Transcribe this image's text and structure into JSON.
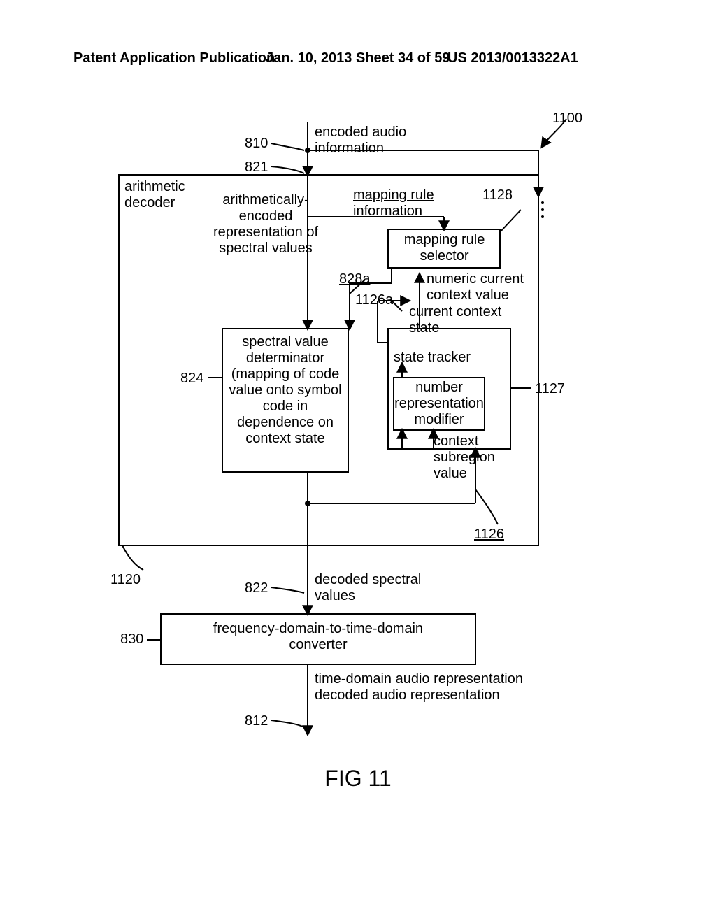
{
  "header": {
    "left": "Patent Application Publication",
    "center": "Jan. 10, 2013  Sheet 34 of 59",
    "right": "US 2013/0013322A1"
  },
  "labels": {
    "encoded_audio": "encoded audio\ninformation",
    "arithmetic_decoder": "arithmetic\ndecoder",
    "arith_encoded": "arithmetically-\nencoded\nrepresentation of\nspectral values",
    "mapping_rule_info": "mapping rule\ninformation",
    "mapping_rule_selector": "mapping rule\nselector",
    "numeric_current": "numeric current\ncontext value",
    "spectral_value_det": "spectral value\ndeterminator\n(mapping of code\nvalue onto symbol\ncode in\ndependence on\ncontext state",
    "current_context_state": "current context\nstate",
    "state_tracker": "state tracker",
    "number_rep_mod": "number\nrepresentation\nmodifier",
    "context_subregion_value": "context\nsubregion\nvalue",
    "decoded_spectral": "decoded spectral\nvalues",
    "converter": "frequency-domain-to-time-domain\nconverter",
    "time_domain": "time-domain audio representation\ndecoded audio representation",
    "ref_810": "810",
    "ref_821": "821",
    "ref_824": "824",
    "ref_828a": "828a",
    "ref_1126a": "1126a",
    "ref_1127": "1127",
    "ref_1128": "1128",
    "ref_1126": "1126",
    "ref_1120": "1120",
    "ref_822": "822",
    "ref_830": "830",
    "ref_812": "812",
    "ref_1100": "1100"
  },
  "figure_caption": "FIG 11"
}
